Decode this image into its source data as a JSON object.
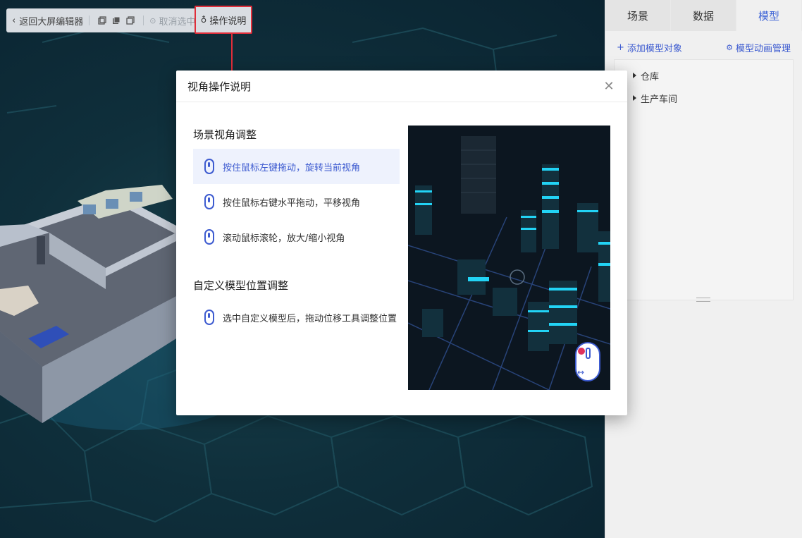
{
  "toolbar": {
    "back_label": "返回大屏编辑器",
    "deselect_label": "取消选中",
    "help_label": "操作说明"
  },
  "right_panel": {
    "tabs": [
      {
        "label": "场景",
        "active": false
      },
      {
        "label": "数据",
        "active": false
      },
      {
        "label": "模型",
        "active": true
      }
    ],
    "add_model_label": "添加模型对象",
    "anim_manage_label": "模型动画管理",
    "tree": [
      {
        "label": "仓库"
      },
      {
        "label": "生产车间"
      }
    ]
  },
  "modal": {
    "title": "视角操作说明",
    "section1_title": "场景视角调整",
    "section1_options": [
      {
        "label": "按住鼠标左键拖动，旋转当前视角",
        "active": true
      },
      {
        "label": "按住鼠标右键水平拖动，平移视角",
        "active": false
      },
      {
        "label": "滚动鼠标滚轮，放大/缩小视角",
        "active": false
      }
    ],
    "section2_title": "自定义模型位置调整",
    "section2_options": [
      {
        "label": "选中自定义模型后，拖动位移工具调整位置",
        "active": false
      }
    ],
    "close_icon": "close-icon"
  },
  "colors": {
    "accent": "#3d5bd0",
    "highlight_border": "#e02e3a",
    "scene_bg": "#0f2f3b"
  }
}
